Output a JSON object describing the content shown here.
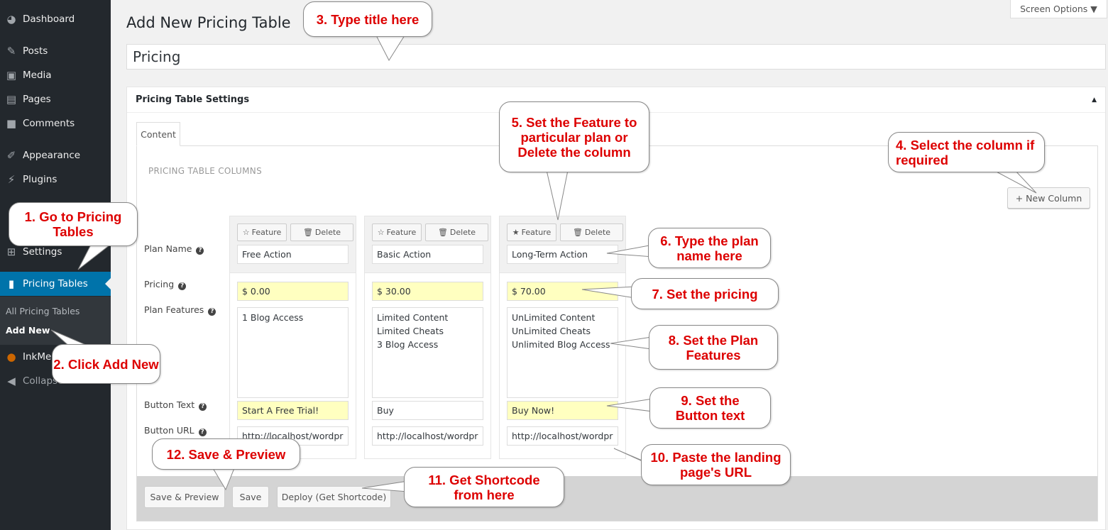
{
  "sidebar": {
    "items": [
      {
        "label": "Dashboard",
        "icon": "dashboard-icon"
      },
      {
        "label": "Posts",
        "icon": "pin-icon"
      },
      {
        "label": "Media",
        "icon": "media-icon"
      },
      {
        "label": "Pages",
        "icon": "pages-icon"
      },
      {
        "label": "Comments",
        "icon": "comment-icon"
      },
      {
        "label": "Appearance",
        "icon": "brush-icon"
      },
      {
        "label": "Plugins",
        "icon": "plugin-icon"
      },
      {
        "label": "Settings",
        "icon": "settings-icon"
      },
      {
        "label": "Pricing Tables",
        "icon": "bar-chart-icon"
      },
      {
        "label": "InkMe",
        "icon": "inkme-icon"
      },
      {
        "label": "Collapse menu",
        "icon": "collapse-icon"
      }
    ],
    "submenu": [
      "All Pricing Tables",
      "Add New"
    ]
  },
  "header": {
    "title": "Add New Pricing Table",
    "screen_options": "Screen Options ▼"
  },
  "title_input": "Pricing",
  "settings": {
    "title": "Pricing Table Settings",
    "tab": "Content",
    "columns_heading": "PRICING TABLE COLUMNS",
    "new_column": "+ New Column",
    "row_labels": [
      "Plan Name",
      "Pricing",
      "Plan Features",
      "Button Text",
      "Button URL"
    ],
    "feature_label": "Feature",
    "delete_label": "Delete"
  },
  "columns": [
    {
      "featured": false,
      "name": "Free Action",
      "price": "$ 0.00",
      "features": "1 Blog Access",
      "button_text": "Start A Free Trial!",
      "button_url": "http://localhost/wordpr"
    },
    {
      "featured": false,
      "name": "Basic Action",
      "price": "$ 30.00",
      "features": "Limited Content\nLimited Cheats\n3 Blog Access",
      "button_text": "Buy",
      "button_url": "http://localhost/wordpr"
    },
    {
      "featured": true,
      "name": "Long-Term Action",
      "price": "$ 70.00",
      "features": "UnLimited Content\nUnLimited Cheats\nUnlimited Blog Access",
      "button_text": "Buy Now!",
      "button_url": "http://localhost/wordpr"
    }
  ],
  "footer": {
    "save_preview": "Save & Preview",
    "save": "Save",
    "deploy": "Deploy (Get Shortcode)"
  },
  "callouts": [
    "1. Go to Pricing Tables",
    "2. Click Add New",
    "3. Type title here",
    "4. Select the column if required",
    "5. Set the Feature to particular plan or Delete the column",
    "6. Type the plan name here",
    "7. Set the pricing",
    "8. Set the Plan Features",
    "9. Set the Button text",
    "10. Paste the landing page's URL",
    "11. Get Shortcode from here",
    "12. Save & Preview"
  ],
  "colors": {
    "sidebar": "#23282d",
    "active": "#0073aa",
    "highlight": "#ffffc0",
    "callout_text": "#dd0000"
  }
}
